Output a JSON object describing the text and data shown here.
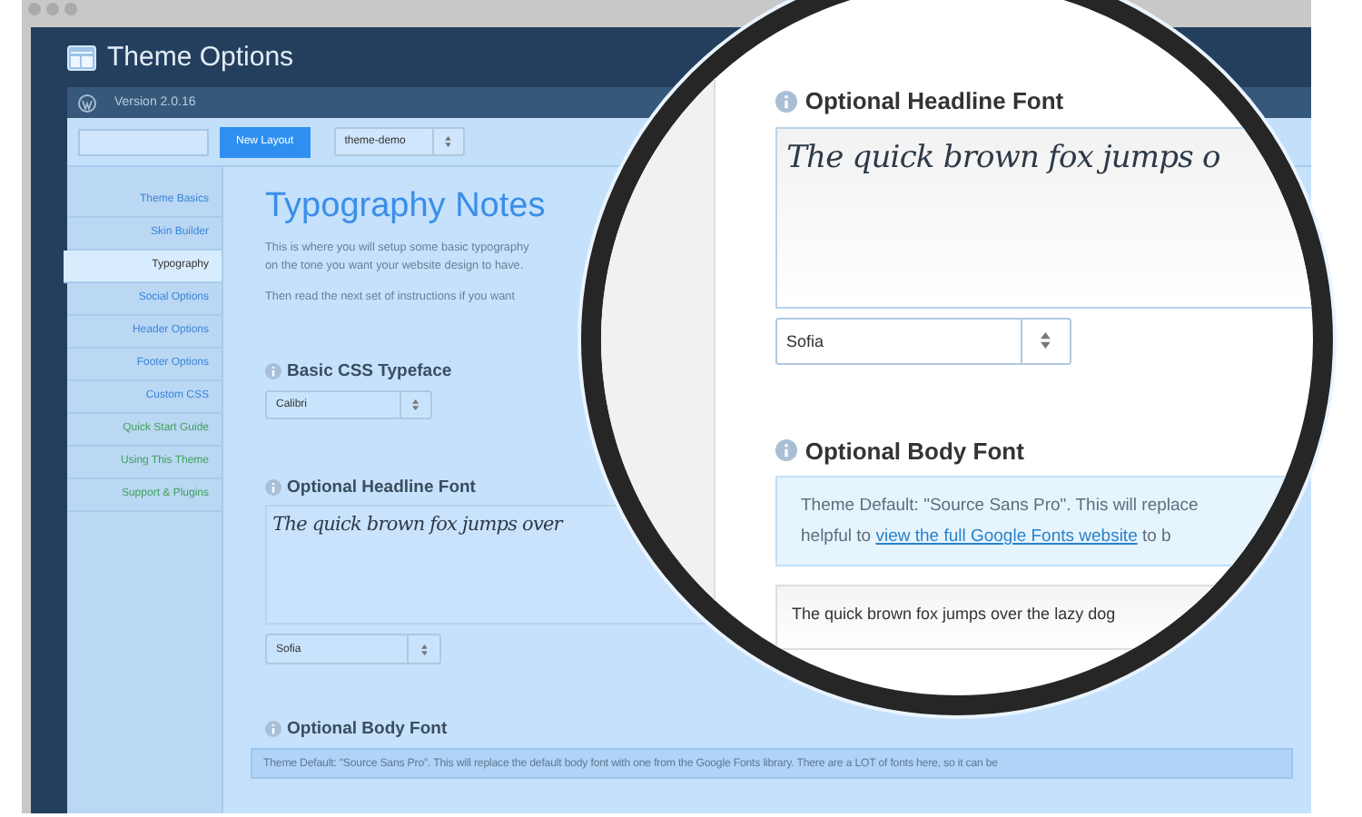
{
  "window": {
    "title": "Theme Options"
  },
  "version": "Version 2.0.16",
  "toolbar": {
    "button": "New Layout",
    "layout_select": "theme-demo"
  },
  "sidebar": {
    "items": [
      {
        "label": "Theme Basics",
        "selected": false,
        "kind": "nav"
      },
      {
        "label": "Skin Builder",
        "selected": false,
        "kind": "nav"
      },
      {
        "label": "Typography",
        "selected": true,
        "kind": "nav"
      },
      {
        "label": "Social Options",
        "selected": false,
        "kind": "nav"
      },
      {
        "label": "Header Options",
        "selected": false,
        "kind": "nav"
      },
      {
        "label": "Footer Options",
        "selected": false,
        "kind": "nav"
      },
      {
        "label": "Custom CSS",
        "selected": false,
        "kind": "nav"
      },
      {
        "label": "Quick Start Guide",
        "selected": false,
        "kind": "help"
      },
      {
        "label": "Using This Theme",
        "selected": false,
        "kind": "help"
      },
      {
        "label": "Support & Plugins",
        "selected": false,
        "kind": "help"
      }
    ]
  },
  "content": {
    "title": "Typography Notes",
    "paragraphs": [
      "This is where you will setup some basic typography",
      "on the tone you want your website design to have.",
      "Then read the next set of instructions if you want"
    ],
    "sections": [
      {
        "kind": "select",
        "title": "Basic CSS Typeface",
        "value": "Calibri"
      },
      {
        "kind": "preview",
        "title": "Optional Headline Font",
        "preview": "The quick brown fox jumps over",
        "value": "Sofia"
      },
      {
        "kind": "notice",
        "title": "Optional Body Font",
        "notice": "Theme Default: \"Source Sans Pro\". This will replace the default body font with one from the Google Fonts library. There are a LOT of fonts here, so it can be"
      }
    ]
  },
  "magnifier": {
    "sections": [
      {
        "kind": "preview",
        "title": "Optional Headline Font",
        "preview": "The quick brown fox jumps o",
        "value": "Sofia"
      },
      {
        "kind": "body",
        "title": "Optional Body Font",
        "notice_line": "Theme Default: \"Source Sans Pro\". This will replace",
        "notice_before": "helpful to",
        "link": "view the full Google Fonts website",
        "notice_after": "to b",
        "sample": "The quick brown fox jumps over the lazy dog"
      }
    ]
  }
}
